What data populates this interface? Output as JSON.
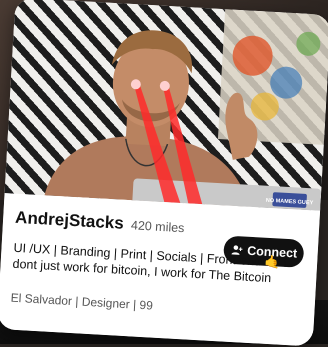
{
  "profile": {
    "username": "AndrejStacks",
    "distance": "420 miles",
    "bio": "UI /UX | Branding | Print | Socials | Front-end 🤙 I dont just work for bitcoin, I work for The Bitcoin",
    "meta": "El Salvador | Designer | 99",
    "laptop_sticker": "NO MAMES GUEY"
  },
  "connect": {
    "label": "Connect",
    "icon": "add-person-icon"
  },
  "colors": {
    "button_bg": "#111111",
    "laser": "#ff2a2a",
    "card_bg": "#ffffff"
  }
}
